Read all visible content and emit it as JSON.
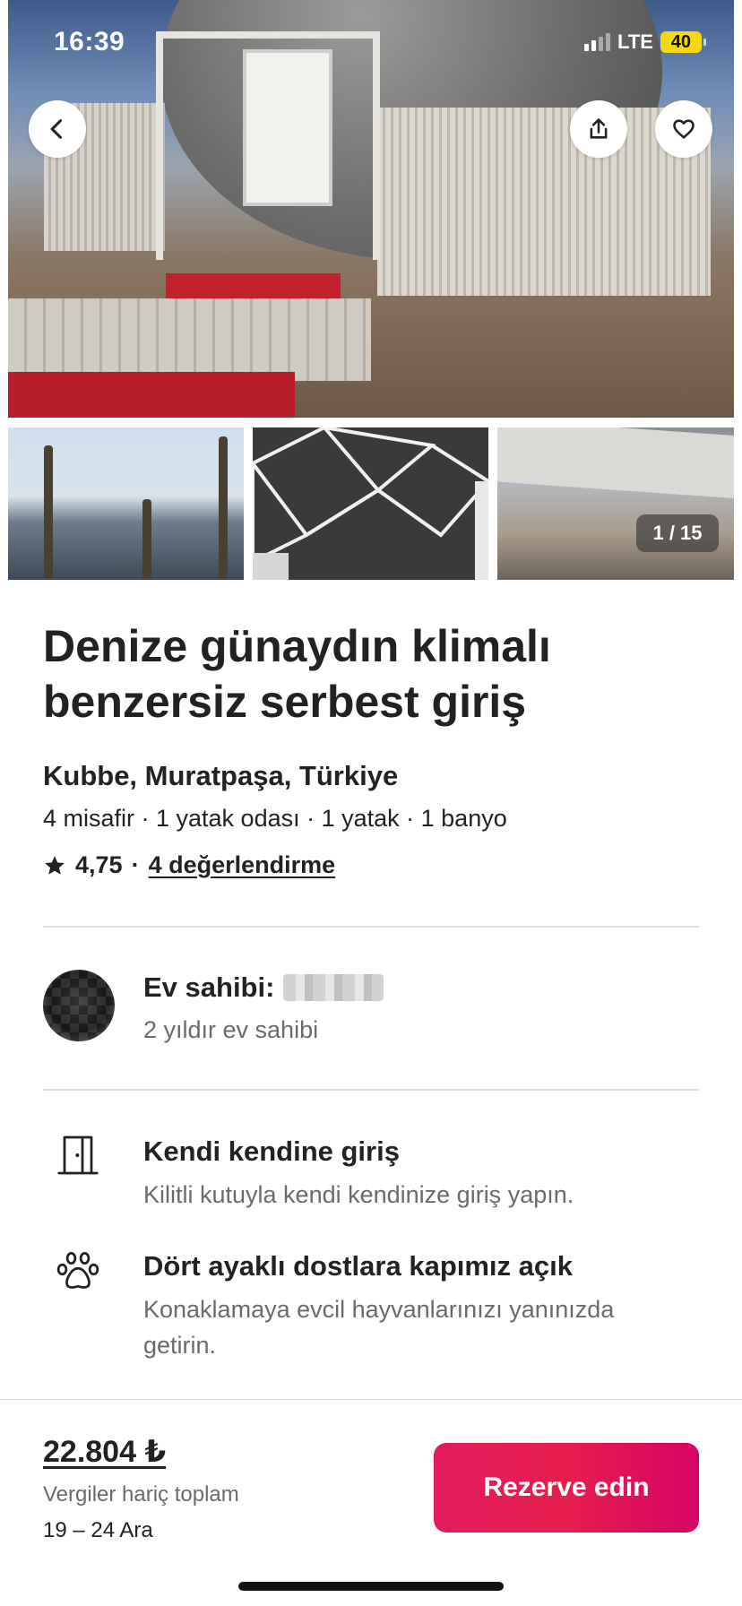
{
  "status_bar": {
    "time": "16:39",
    "network": "LTE",
    "battery": "40",
    "battery_color": "#f5d90a"
  },
  "hero": {
    "back_icon": "chevron-left-icon",
    "share_icon": "share-icon",
    "favorite_icon": "heart-icon"
  },
  "gallery": {
    "counter": "1 / 15"
  },
  "listing": {
    "title_line1": "Denize günaydın klimalı",
    "title_line2": "benzersiz serbest giriş",
    "location": "Kubbe, Muratpaşa, Türkiye",
    "details": "4 misafir · 1 yatak odası · 1 yatak · 1 banyo",
    "rating": "4,75",
    "rating_separator": "·",
    "reviews": "4 değerlendirme"
  },
  "host": {
    "label": "Ev sahibi:",
    "subtitle": "2 yıldır ev sahibi"
  },
  "features": [
    {
      "icon": "door-icon",
      "title": "Kendi kendine giriş",
      "description": "Kilitli kutuyla kendi kendinize giriş yapın."
    },
    {
      "icon": "paw-icon",
      "title": "Dört ayaklı dostlara kapımız açık",
      "description": "Konaklamaya evcil hayvanlarınızı yanınızda getirin."
    }
  ],
  "booking": {
    "price": "22.804 ₺",
    "price_note": "Vergiler hariç toplam",
    "dates": "19 – 24 Ara",
    "reserve_label": "Rezerve edin",
    "accent_color": "#e31c5f"
  }
}
